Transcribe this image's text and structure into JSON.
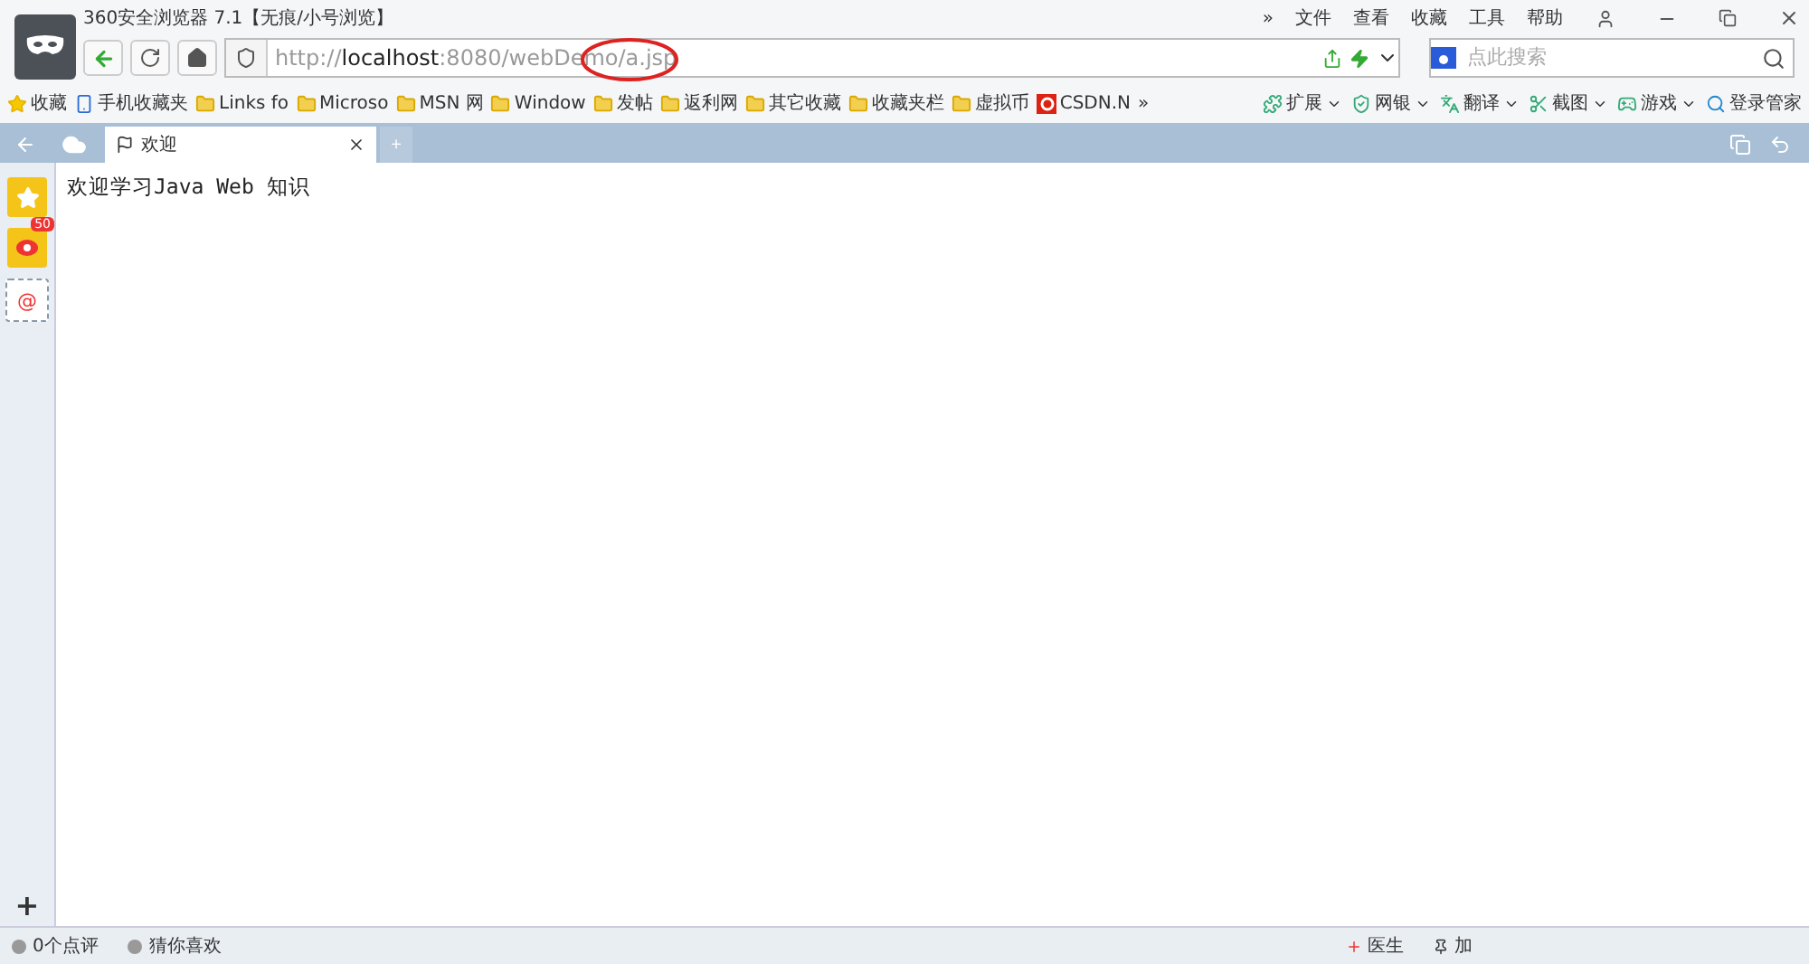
{
  "window": {
    "title": "360安全浏览器 7.1【无痕/小号浏览】",
    "menu": [
      "»",
      "文件",
      "查看",
      "收藏",
      "工具",
      "帮助"
    ]
  },
  "address_bar": {
    "scheme": "http://",
    "host": "localhost",
    "rest": ":8080/webDemo/a.jsp"
  },
  "search": {
    "placeholder": "点此搜索"
  },
  "bookmarks": [
    {
      "label": "收藏",
      "kind": "star"
    },
    {
      "label": "手机收藏夹",
      "kind": "phone"
    },
    {
      "label": "Links fo",
      "kind": "folder"
    },
    {
      "label": "Microso",
      "kind": "folder"
    },
    {
      "label": "MSN 网",
      "kind": "folder"
    },
    {
      "label": "Window",
      "kind": "folder"
    },
    {
      "label": "发帖",
      "kind": "folder"
    },
    {
      "label": "返利网",
      "kind": "folder"
    },
    {
      "label": "其它收藏",
      "kind": "folder"
    },
    {
      "label": "收藏夹栏",
      "kind": "folder"
    },
    {
      "label": "虚拟币",
      "kind": "folder"
    },
    {
      "label": "CSDN.N",
      "kind": "csdn"
    }
  ],
  "bookmarks_more": "»",
  "tools": [
    "扩展",
    "网银",
    "翻译",
    "截图",
    "游戏"
  ],
  "login": "登录管家",
  "tabs": [
    {
      "label": "欢迎",
      "selected": true
    }
  ],
  "new_tab": "+",
  "sidebar": {
    "badge": "50",
    "mail": "@",
    "add": "+"
  },
  "page": {
    "text": "欢迎学习Java Web 知识"
  },
  "status_bar": {
    "left": [
      "0个点评",
      "猜你喜欢"
    ],
    "right": [
      "医生",
      "加"
    ]
  }
}
